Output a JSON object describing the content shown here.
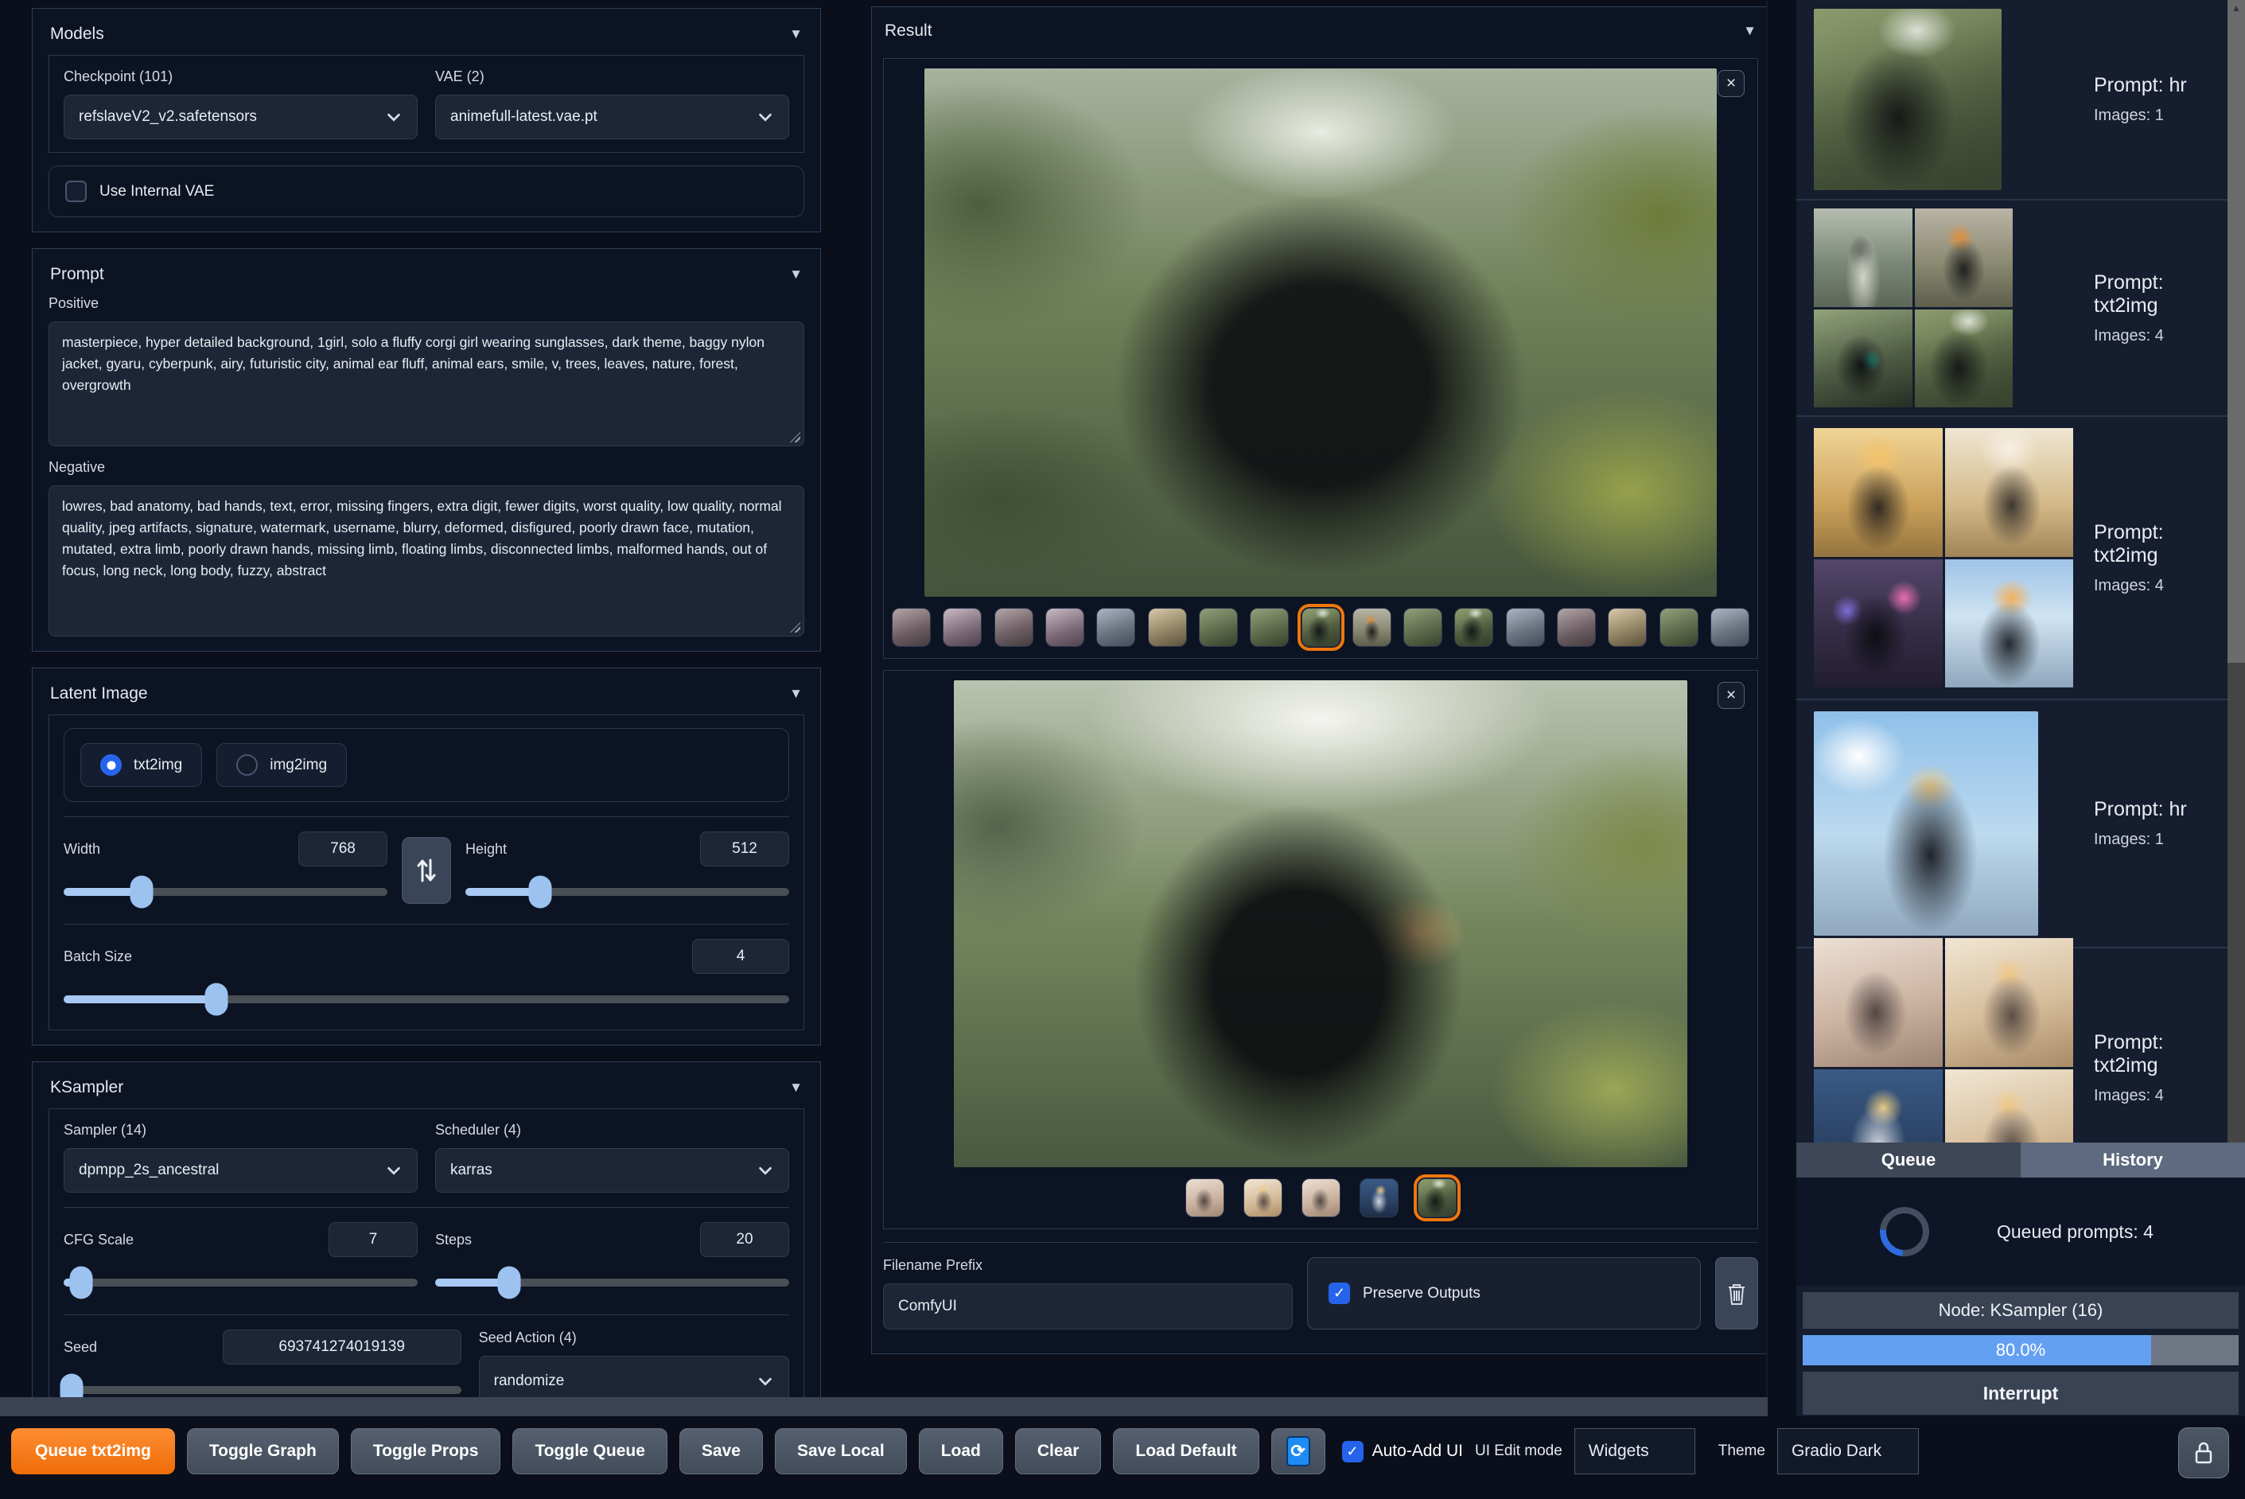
{
  "icons": {
    "collapse": "▼",
    "scroll_up": "▲",
    "close": "×",
    "check": "✓",
    "refresh": "⟳"
  },
  "colors": {
    "accent_orange": "#f0760c",
    "accent_blue": "#2563eb",
    "slider_blue": "#a7c9f4",
    "progress_blue": "#64a0f2",
    "panel_bg": "#0c1322",
    "right_panel_bg": "#151d2f"
  },
  "models": {
    "title": "Models",
    "checkpoint_label": "Checkpoint (101)",
    "checkpoint_value": "refslaveV2_v2.safetensors",
    "vae_label": "VAE (2)",
    "vae_value": "animefull-latest.vae.pt",
    "use_internal_vae_label": "Use Internal VAE"
  },
  "prompt": {
    "title": "Prompt",
    "positive_label": "Positive",
    "positive_value": "masterpiece, hyper detailed background, 1girl, solo a fluffy corgi girl wearing sunglasses, dark theme, baggy nylon jacket, gyaru, cyberpunk, airy, futuristic city, animal ear fluff, animal ears, smile, v, trees, leaves, nature, forest, overgrowth",
    "negative_label": "Negative",
    "negative_value": "lowres, bad anatomy, bad hands, text, error, missing fingers, extra digit, fewer digits, worst quality, low quality, normal quality, jpeg artifacts, signature, watermark, username, blurry, deformed, disfigured, poorly drawn face, mutation, mutated, extra limb, poorly drawn hands, missing limb, floating limbs, disconnected limbs, malformed hands, out of focus, long neck, long body, fuzzy, abstract"
  },
  "latent": {
    "title": "Latent Image",
    "mode_txt2img": "txt2img",
    "mode_img2img": "img2img",
    "selected_mode": "txt2img",
    "width_label": "Width",
    "width_value": "768",
    "height_label": "Height",
    "height_value": "512",
    "batch_label": "Batch Size",
    "batch_value": "4"
  },
  "ksampler": {
    "title": "KSampler",
    "sampler_label": "Sampler (14)",
    "sampler_value": "dpmpp_2s_ancestral",
    "scheduler_label": "Scheduler (4)",
    "scheduler_value": "karras",
    "cfg_label": "CFG Scale",
    "cfg_value": "7",
    "steps_label": "Steps",
    "steps_value": "20",
    "seed_label": "Seed",
    "seed_value": "693741274019139",
    "seed_action_label": "Seed Action (4)",
    "seed_action_value": "randomize"
  },
  "result": {
    "title": "Result",
    "filename_prefix_label": "Filename Prefix",
    "filename_prefix_value": "ComfyUI",
    "preserve_outputs_label": "Preserve Outputs"
  },
  "history": {
    "items": [
      {
        "prompt": "Prompt: hr",
        "images": "Images: 1"
      },
      {
        "prompt": "Prompt: txt2img",
        "images": "Images: 4"
      },
      {
        "prompt": "Prompt: txt2img",
        "images": "Images: 4"
      },
      {
        "prompt": "Prompt: hr",
        "images": "Images: 1"
      },
      {
        "prompt": "Prompt: txt2img",
        "images": "Images: 4"
      }
    ],
    "tab_queue": "Queue",
    "tab_history": "History",
    "queued_prompts": "Queued prompts: 4",
    "node_label": "Node: KSampler (16)",
    "progress_text": "80.0%",
    "interrupt_label": "Interrupt"
  },
  "toolbar": {
    "queue_txt2img": "Queue txt2img",
    "toggle_graph": "Toggle Graph",
    "toggle_props": "Toggle Props",
    "toggle_queue": "Toggle Queue",
    "save": "Save",
    "save_local": "Save Local",
    "load": "Load",
    "clear": "Clear",
    "load_default": "Load Default",
    "auto_add_ui": "Auto-Add UI",
    "ui_edit_mode": "UI Edit mode",
    "widgets_value": "Widgets",
    "theme_label": "Theme",
    "theme_value": "Gradio Dark"
  }
}
